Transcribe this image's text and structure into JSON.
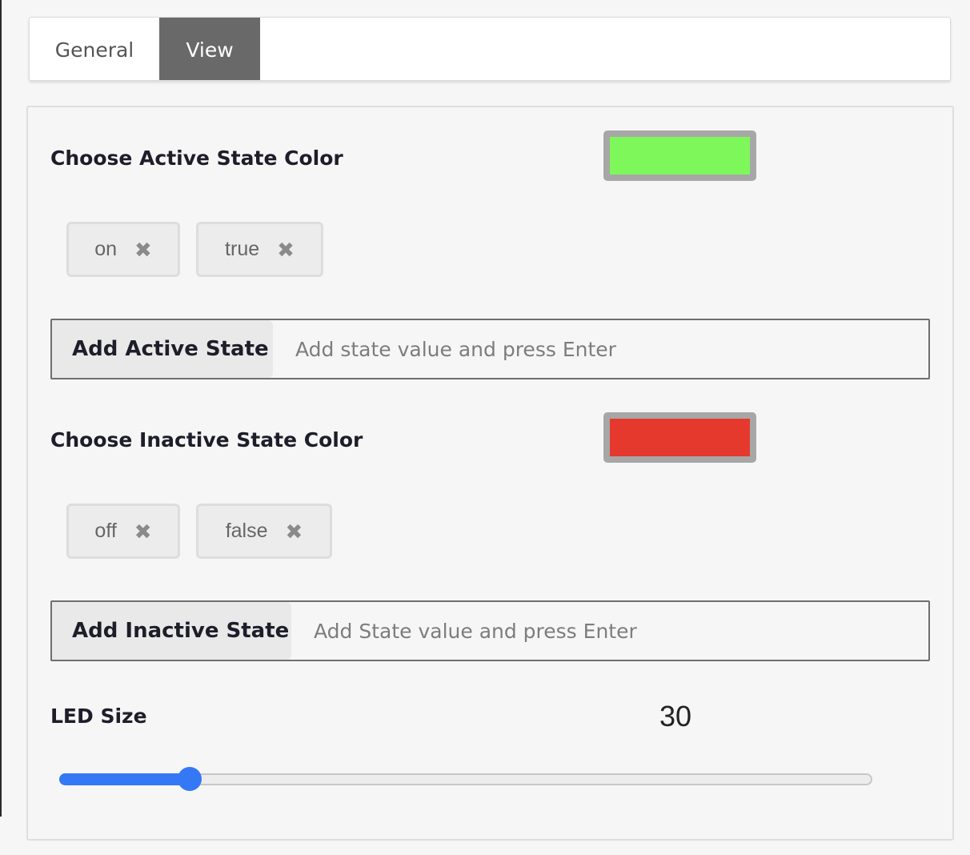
{
  "tabs": {
    "general": "General",
    "view": "View"
  },
  "active_section": {
    "label": "Choose Active State Color",
    "color": "#7ef75a",
    "chips": [
      "on",
      "true"
    ],
    "add_button": "Add Active State",
    "placeholder": "Add state value and press Enter"
  },
  "inactive_section": {
    "label": "Choose Inactive State Color",
    "color": "#e5392e",
    "chips": [
      "off",
      "false"
    ],
    "add_button": "Add Inactive State",
    "placeholder": "Add State value and press Enter"
  },
  "led_size": {
    "label": "LED Size",
    "value": "30",
    "min": 0,
    "max": 200
  },
  "chip_remove_glyph": "✖"
}
